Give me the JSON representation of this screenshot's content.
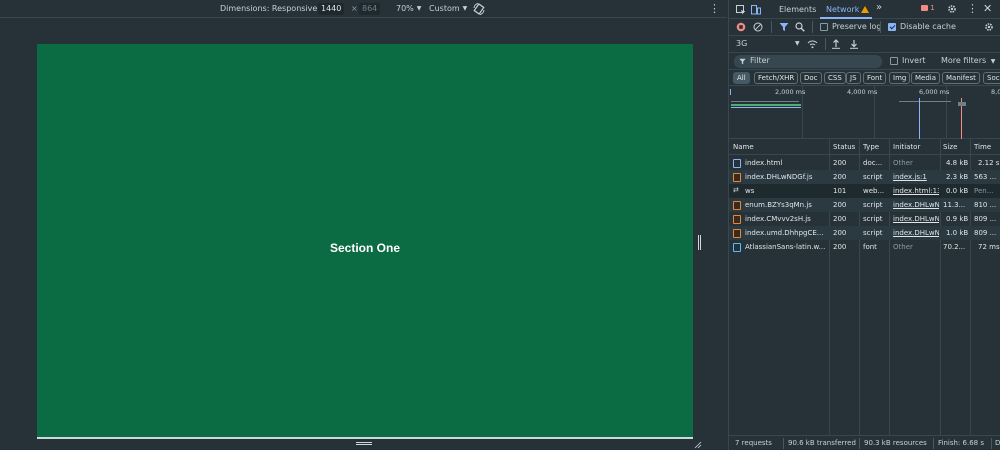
{
  "device_toolbar": {
    "dimensions_label": "Dimensions: Responsive",
    "width_value": "1440",
    "times": "×",
    "height_value": "864",
    "zoom": "70%",
    "throttle": "Custom"
  },
  "viewport": {
    "section_title": "Section One",
    "background": "#0b6b43"
  },
  "devtools": {
    "tabs": {
      "elements": "Elements",
      "network": "Network",
      "more": "»"
    },
    "error_count": "1",
    "toolbar": {
      "preserve_log": "Preserve log",
      "preserve_log_checked": false,
      "disable_cache": "Disable cache",
      "disable_cache_checked": true,
      "throttling": "3G"
    },
    "filter": {
      "placeholder": "Filter",
      "invert": "Invert",
      "more_filters": "More filters"
    },
    "type_filters": [
      "All",
      "Fetch/XHR",
      "Doc",
      "CSS",
      "JS",
      "Font",
      "Img",
      "Media",
      "Manifest",
      "Sock"
    ],
    "overview": {
      "ticks": [
        "2,000 ms",
        "4,000 ms",
        "6,000 ms",
        "8,0"
      ]
    },
    "columns": [
      "Name",
      "Status",
      "Type",
      "Initiator",
      "Size",
      "Time"
    ],
    "requests": [
      {
        "name": "index.html",
        "status": "200",
        "type": "doc...",
        "initiator": "Other",
        "size": "4.8 kB",
        "time": "2.12 s",
        "icon": "doc"
      },
      {
        "name": "index.DHLwNDGf.js",
        "status": "200",
        "type": "script",
        "initiator": "index.js:1",
        "size": "2.3 kB",
        "time": "563 ...",
        "icon": "js"
      },
      {
        "name": "ws",
        "status": "101",
        "type": "web...",
        "initiator": "index.html:13",
        "size": "0.0 kB",
        "time": "Pen...",
        "icon": "ws"
      },
      {
        "name": "enum.BZYs3qMn.js",
        "status": "200",
        "type": "script",
        "initiator": "index.DHLwN",
        "size": "11.3...",
        "time": "810 ...",
        "icon": "js"
      },
      {
        "name": "index.CMvvv2sH.js",
        "status": "200",
        "type": "script",
        "initiator": "index.DHLwN",
        "size": "0.9 kB",
        "time": "809 ...",
        "icon": "js"
      },
      {
        "name": "index.umd.DhhpgCE...",
        "status": "200",
        "type": "script",
        "initiator": "index.DHLwN",
        "size": "1.0 kB",
        "time": "809 ...",
        "icon": "js"
      },
      {
        "name": "AtlassianSans-latin.w...",
        "status": "200",
        "type": "font",
        "initiator": "Other",
        "size": "70.2...",
        "time": "72 ms",
        "icon": "font"
      }
    ],
    "status_bar": {
      "requests": "7 requests",
      "transferred": "90.6 kB transferred",
      "resources": "90.3 kB resources",
      "finish": "Finish: 6.68 s",
      "more": "D"
    }
  }
}
